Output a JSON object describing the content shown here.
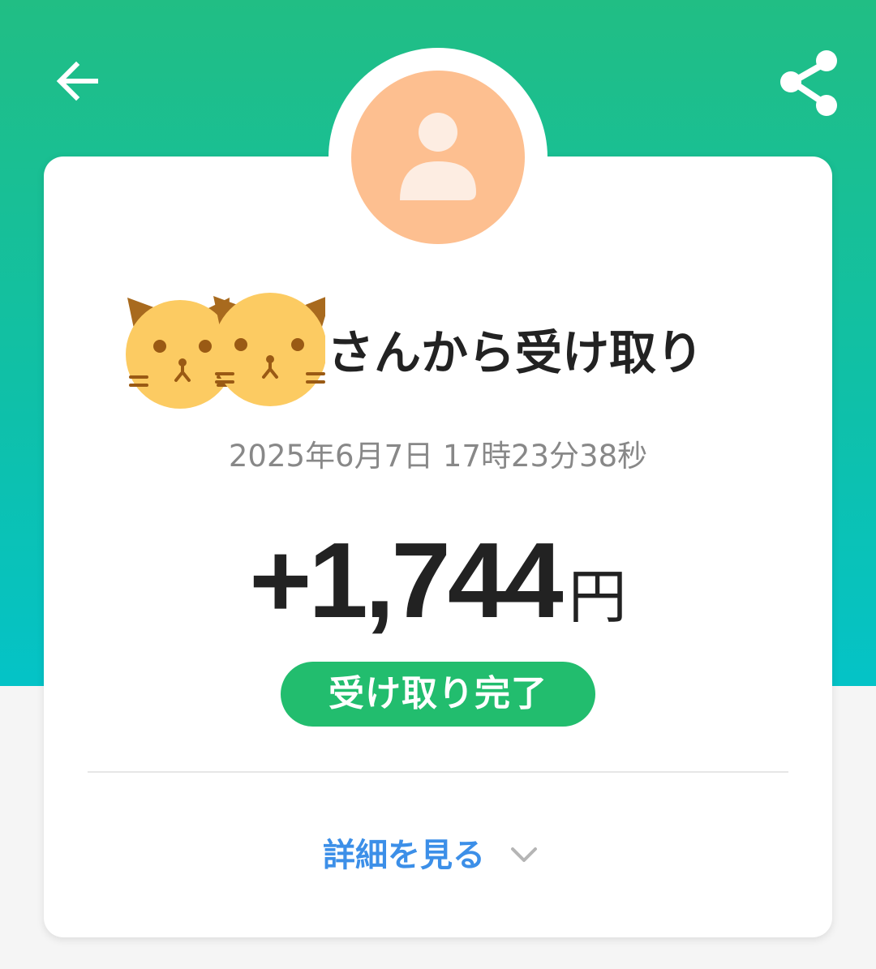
{
  "header": {
    "back_icon": "arrow-left-icon",
    "share_icon": "share-icon",
    "background_top": "#21be84",
    "background_bottom": "#04c3c7"
  },
  "card": {
    "avatar_icon": "person-icon",
    "avatar_color": "#fdbf90",
    "sender_stickers": [
      "cat-face-sticker",
      "cat-face-sticker"
    ],
    "sender_suffix": "さんから受け取り",
    "timestamp": "2025年6月7日 17時23分38秒",
    "amount": "+1,744",
    "currency_unit": "円",
    "status": "受け取り完了",
    "status_color": "#22bd6e",
    "details_label": "詳細を見る",
    "details_icon": "chevron-down-icon",
    "link_color": "#3c8fe8"
  }
}
